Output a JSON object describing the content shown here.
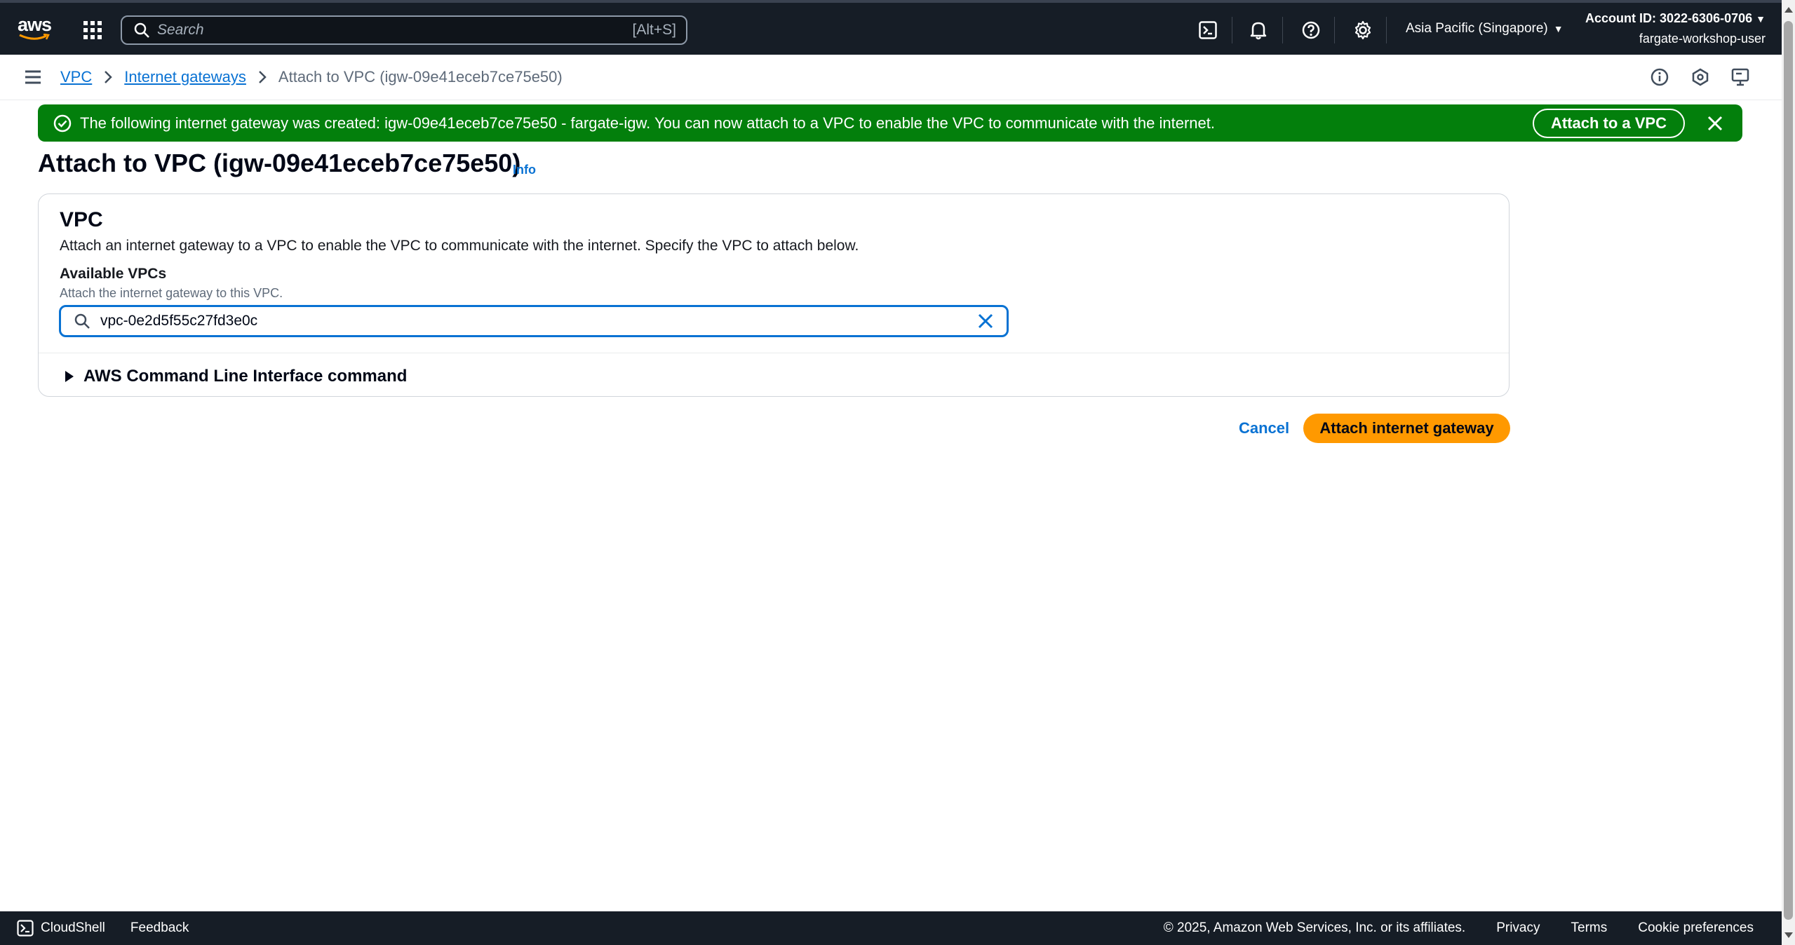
{
  "topnav": {
    "logo": "aws",
    "search_placeholder": "Search",
    "search_shortcut": "[Alt+S]",
    "region": "Asia Pacific (Singapore)",
    "account_id": "Account ID: 3022-6306-0706",
    "user": "fargate-workshop-user",
    "icons": [
      "cloudshell-icon",
      "bell-icon",
      "help-icon",
      "gear-icon"
    ]
  },
  "breadcrumb": {
    "items": [
      "VPC",
      "Internet gateways"
    ],
    "current": "Attach to VPC (igw-09e41eceb7ce75e50)"
  },
  "flash": {
    "message": "The following internet gateway was created: igw-09e41eceb7ce75e50 - fargate-igw. You can now attach to a VPC to enable the VPC to communicate with the internet.",
    "action_label": "Attach to a VPC",
    "type": "success",
    "color": "#037f0c"
  },
  "page": {
    "title": "Attach to VPC (igw-09e41eceb7ce75e50)",
    "info_link": "Info"
  },
  "panel": {
    "heading": "VPC",
    "description": "Attach an internet gateway to a VPC to enable the VPC to communicate with the internet. Specify the VPC to attach below.",
    "field_label": "Available VPCs",
    "field_hint": "Attach the internet gateway to this VPC.",
    "field_value": "vpc-0e2d5f55c27fd3e0c",
    "cli_section": "AWS Command Line Interface command"
  },
  "actions": {
    "cancel": "Cancel",
    "primary": "Attach internet gateway",
    "primary_color": "#ff9900"
  },
  "footer": {
    "cloudshell": "CloudShell",
    "feedback": "Feedback",
    "copyright": "© 2025, Amazon Web Services, Inc. or its affiliates.",
    "privacy": "Privacy",
    "terms": "Terms",
    "cookies": "Cookie preferences"
  }
}
